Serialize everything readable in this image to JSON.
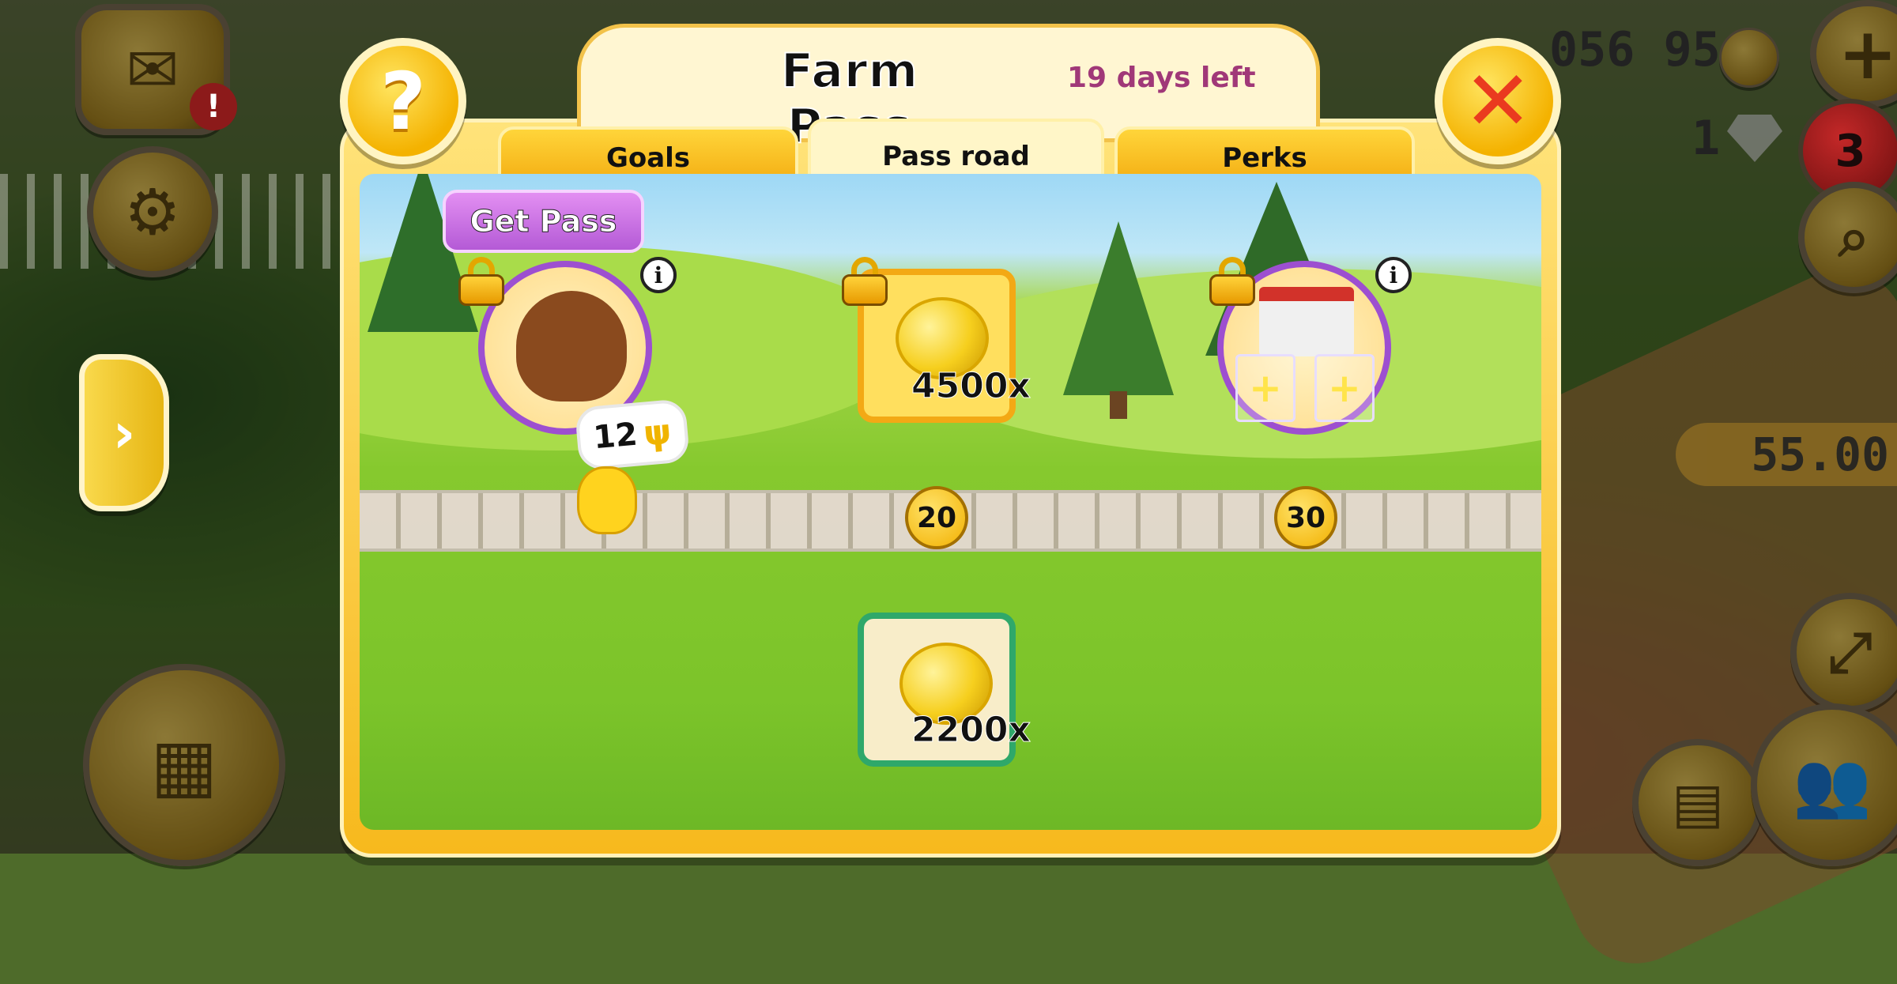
{
  "hud": {
    "coins_partial": "056 954",
    "diamonds": "1",
    "badge_count": "3",
    "money": "55.00"
  },
  "dialog": {
    "title": "Farm Pass",
    "days_left": "19 days left",
    "help_icon_text": "?",
    "close_icon_text": "✕",
    "tabs": [
      {
        "label": "Goals",
        "active": false
      },
      {
        "label": "Pass road",
        "active": true
      },
      {
        "label": "Perks",
        "active": false
      }
    ],
    "get_pass_label": "Get Pass",
    "road": {
      "current_level": "12",
      "milestones": [
        "20",
        "30"
      ],
      "premium_rewards": [
        {
          "kind": "horse-item",
          "locked": true,
          "has_info": true
        },
        {
          "kind": "coins",
          "amount": "4500x",
          "locked": true
        },
        {
          "kind": "decorations",
          "locked": true,
          "has_info": true
        }
      ],
      "free_rewards": [
        {
          "kind": "coins",
          "amount": "2200x"
        }
      ]
    },
    "info_glyph": "i"
  },
  "colors": {
    "frame": "#f7b91d",
    "premium_ring": "#9d4fd0",
    "free_border": "#2fa86a",
    "days_text": "#a03878",
    "close_x": "#ea3a1f"
  }
}
